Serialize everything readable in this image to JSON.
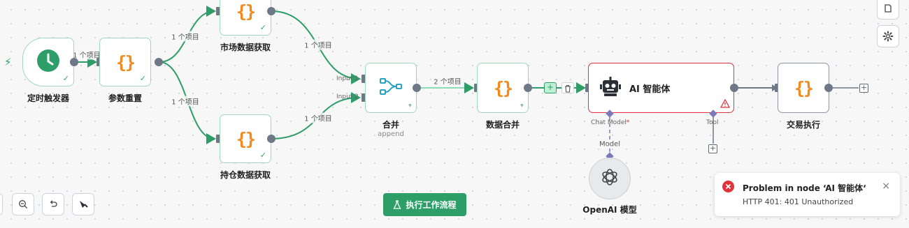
{
  "nodes": {
    "trigger": {
      "label": "定时触发器"
    },
    "params": {
      "label": "参数重置"
    },
    "market": {
      "label": "市场数据获取"
    },
    "holdings": {
      "label": "持仓数据获取"
    },
    "merge": {
      "label": "合并",
      "sublabel": "append",
      "input1": "Input 1",
      "input2": "Input 2"
    },
    "data_merge": {
      "label": "数据合并"
    },
    "agent": {
      "label": "AI 智能体",
      "chat_model_port": "Chat Model",
      "required_mark": "*",
      "tool_port": "Tool"
    },
    "trade": {
      "label": "交易执行"
    },
    "openai": {
      "label": "OpenAI 模型"
    }
  },
  "edge_labels": {
    "trigger_params": "1 个项目",
    "params_market": "1 个项目",
    "params_holdings": "1 个项目",
    "market_merge": "1 个项目",
    "holdings_merge": "1 个项目",
    "merge_datamerge": "2 个项目",
    "model_link": "Model"
  },
  "run_button": {
    "label": "执行工作流程"
  },
  "toast": {
    "title": "Problem in node ‘AI 智能体‘",
    "message": "HTTP 401: 401 Unauthorized"
  },
  "colors": {
    "success": "#2e9e68",
    "node_border": "#9fd9b8",
    "error": "#e0333b",
    "code_icon": "#f28a1e",
    "ai_model_diamond": "#7b79b8"
  },
  "icons": {
    "trigger": "clock-icon",
    "code": "braces-icon",
    "merge": "merge-icon",
    "agent": "robot-icon",
    "openai": "openai-icon",
    "warning": "warning-icon",
    "error": "error-icon"
  }
}
